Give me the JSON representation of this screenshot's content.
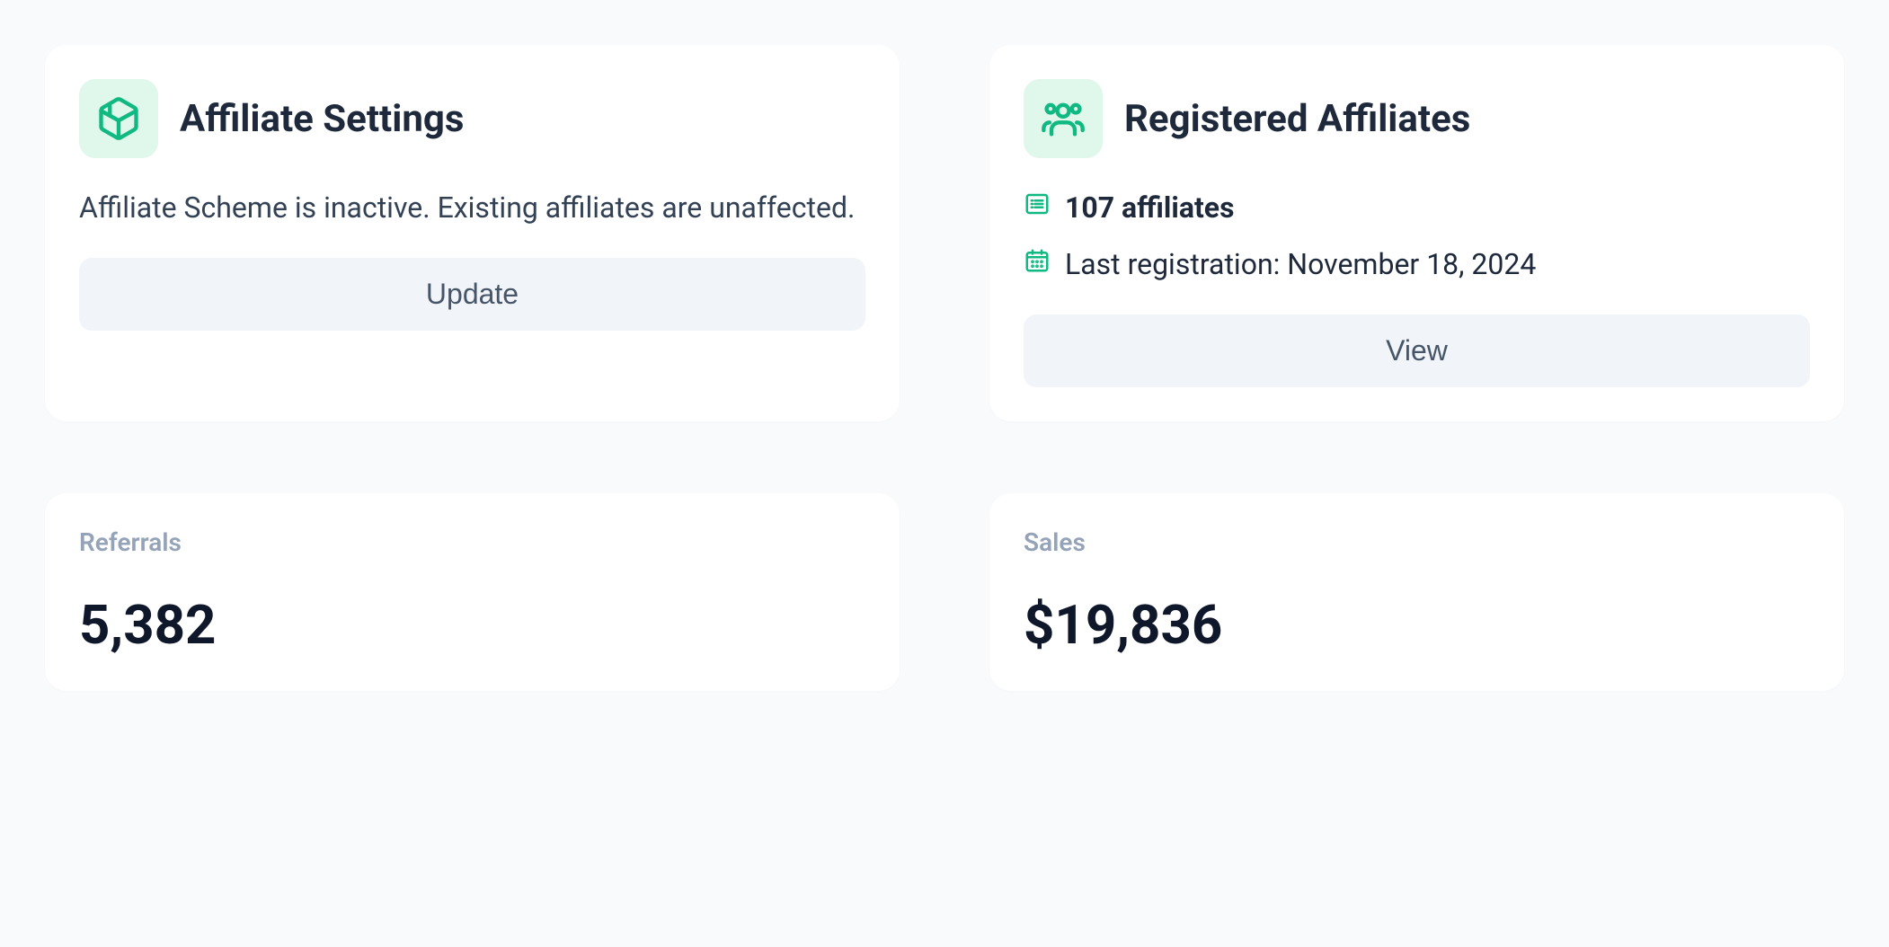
{
  "settings": {
    "title": "Affiliate Settings",
    "description": "Affiliate Scheme is inactive. Existing affiliates are unaffected.",
    "button_label": "Update"
  },
  "registered": {
    "title": "Registered Affiliates",
    "count_text": "107 affiliates",
    "last_registration_text": "Last registration: November 18, 2024",
    "button_label": "View"
  },
  "stats": {
    "referrals": {
      "label": "Referrals",
      "value": "5,382"
    },
    "sales": {
      "label": "Sales",
      "value": "$19,836"
    }
  }
}
